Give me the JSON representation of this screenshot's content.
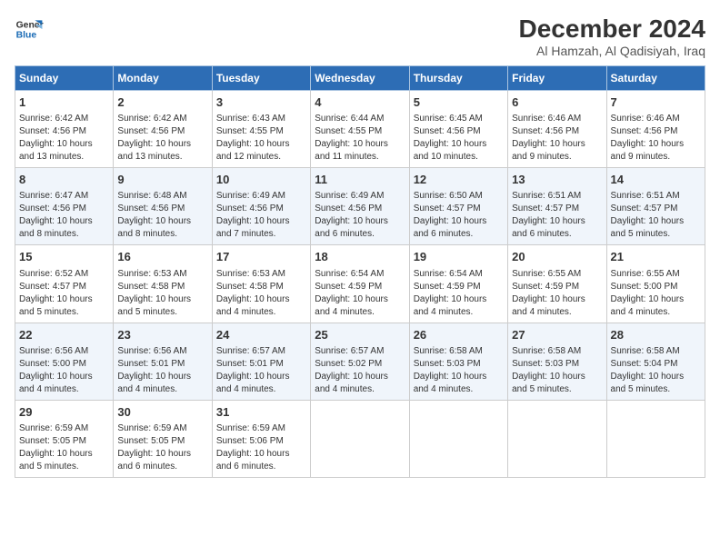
{
  "header": {
    "logo_line1": "General",
    "logo_line2": "Blue",
    "title": "December 2024",
    "subtitle": "Al Hamzah, Al Qadisiyah, Iraq"
  },
  "days_of_week": [
    "Sunday",
    "Monday",
    "Tuesday",
    "Wednesday",
    "Thursday",
    "Friday",
    "Saturday"
  ],
  "weeks": [
    [
      {
        "day": "1",
        "sunrise": "Sunrise: 6:42 AM",
        "sunset": "Sunset: 4:56 PM",
        "daylight": "Daylight: 10 hours and 13 minutes."
      },
      {
        "day": "2",
        "sunrise": "Sunrise: 6:42 AM",
        "sunset": "Sunset: 4:56 PM",
        "daylight": "Daylight: 10 hours and 13 minutes."
      },
      {
        "day": "3",
        "sunrise": "Sunrise: 6:43 AM",
        "sunset": "Sunset: 4:55 PM",
        "daylight": "Daylight: 10 hours and 12 minutes."
      },
      {
        "day": "4",
        "sunrise": "Sunrise: 6:44 AM",
        "sunset": "Sunset: 4:55 PM",
        "daylight": "Daylight: 10 hours and 11 minutes."
      },
      {
        "day": "5",
        "sunrise": "Sunrise: 6:45 AM",
        "sunset": "Sunset: 4:56 PM",
        "daylight": "Daylight: 10 hours and 10 minutes."
      },
      {
        "day": "6",
        "sunrise": "Sunrise: 6:46 AM",
        "sunset": "Sunset: 4:56 PM",
        "daylight": "Daylight: 10 hours and 9 minutes."
      },
      {
        "day": "7",
        "sunrise": "Sunrise: 6:46 AM",
        "sunset": "Sunset: 4:56 PM",
        "daylight": "Daylight: 10 hours and 9 minutes."
      }
    ],
    [
      {
        "day": "8",
        "sunrise": "Sunrise: 6:47 AM",
        "sunset": "Sunset: 4:56 PM",
        "daylight": "Daylight: 10 hours and 8 minutes."
      },
      {
        "day": "9",
        "sunrise": "Sunrise: 6:48 AM",
        "sunset": "Sunset: 4:56 PM",
        "daylight": "Daylight: 10 hours and 8 minutes."
      },
      {
        "day": "10",
        "sunrise": "Sunrise: 6:49 AM",
        "sunset": "Sunset: 4:56 PM",
        "daylight": "Daylight: 10 hours and 7 minutes."
      },
      {
        "day": "11",
        "sunrise": "Sunrise: 6:49 AM",
        "sunset": "Sunset: 4:56 PM",
        "daylight": "Daylight: 10 hours and 6 minutes."
      },
      {
        "day": "12",
        "sunrise": "Sunrise: 6:50 AM",
        "sunset": "Sunset: 4:57 PM",
        "daylight": "Daylight: 10 hours and 6 minutes."
      },
      {
        "day": "13",
        "sunrise": "Sunrise: 6:51 AM",
        "sunset": "Sunset: 4:57 PM",
        "daylight": "Daylight: 10 hours and 6 minutes."
      },
      {
        "day": "14",
        "sunrise": "Sunrise: 6:51 AM",
        "sunset": "Sunset: 4:57 PM",
        "daylight": "Daylight: 10 hours and 5 minutes."
      }
    ],
    [
      {
        "day": "15",
        "sunrise": "Sunrise: 6:52 AM",
        "sunset": "Sunset: 4:57 PM",
        "daylight": "Daylight: 10 hours and 5 minutes."
      },
      {
        "day": "16",
        "sunrise": "Sunrise: 6:53 AM",
        "sunset": "Sunset: 4:58 PM",
        "daylight": "Daylight: 10 hours and 5 minutes."
      },
      {
        "day": "17",
        "sunrise": "Sunrise: 6:53 AM",
        "sunset": "Sunset: 4:58 PM",
        "daylight": "Daylight: 10 hours and 4 minutes."
      },
      {
        "day": "18",
        "sunrise": "Sunrise: 6:54 AM",
        "sunset": "Sunset: 4:59 PM",
        "daylight": "Daylight: 10 hours and 4 minutes."
      },
      {
        "day": "19",
        "sunrise": "Sunrise: 6:54 AM",
        "sunset": "Sunset: 4:59 PM",
        "daylight": "Daylight: 10 hours and 4 minutes."
      },
      {
        "day": "20",
        "sunrise": "Sunrise: 6:55 AM",
        "sunset": "Sunset: 4:59 PM",
        "daylight": "Daylight: 10 hours and 4 minutes."
      },
      {
        "day": "21",
        "sunrise": "Sunrise: 6:55 AM",
        "sunset": "Sunset: 5:00 PM",
        "daylight": "Daylight: 10 hours and 4 minutes."
      }
    ],
    [
      {
        "day": "22",
        "sunrise": "Sunrise: 6:56 AM",
        "sunset": "Sunset: 5:00 PM",
        "daylight": "Daylight: 10 hours and 4 minutes."
      },
      {
        "day": "23",
        "sunrise": "Sunrise: 6:56 AM",
        "sunset": "Sunset: 5:01 PM",
        "daylight": "Daylight: 10 hours and 4 minutes."
      },
      {
        "day": "24",
        "sunrise": "Sunrise: 6:57 AM",
        "sunset": "Sunset: 5:01 PM",
        "daylight": "Daylight: 10 hours and 4 minutes."
      },
      {
        "day": "25",
        "sunrise": "Sunrise: 6:57 AM",
        "sunset": "Sunset: 5:02 PM",
        "daylight": "Daylight: 10 hours and 4 minutes."
      },
      {
        "day": "26",
        "sunrise": "Sunrise: 6:58 AM",
        "sunset": "Sunset: 5:03 PM",
        "daylight": "Daylight: 10 hours and 4 minutes."
      },
      {
        "day": "27",
        "sunrise": "Sunrise: 6:58 AM",
        "sunset": "Sunset: 5:03 PM",
        "daylight": "Daylight: 10 hours and 5 minutes."
      },
      {
        "day": "28",
        "sunrise": "Sunrise: 6:58 AM",
        "sunset": "Sunset: 5:04 PM",
        "daylight": "Daylight: 10 hours and 5 minutes."
      }
    ],
    [
      {
        "day": "29",
        "sunrise": "Sunrise: 6:59 AM",
        "sunset": "Sunset: 5:05 PM",
        "daylight": "Daylight: 10 hours and 5 minutes."
      },
      {
        "day": "30",
        "sunrise": "Sunrise: 6:59 AM",
        "sunset": "Sunset: 5:05 PM",
        "daylight": "Daylight: 10 hours and 6 minutes."
      },
      {
        "day": "31",
        "sunrise": "Sunrise: 6:59 AM",
        "sunset": "Sunset: 5:06 PM",
        "daylight": "Daylight: 10 hours and 6 minutes."
      },
      null,
      null,
      null,
      null
    ]
  ]
}
